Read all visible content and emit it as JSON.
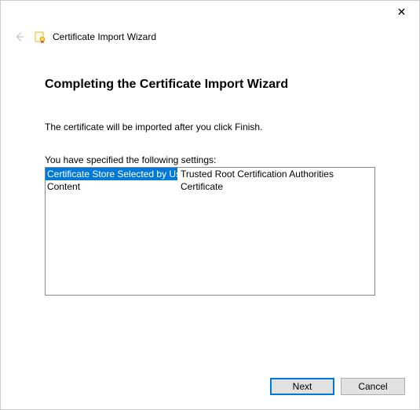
{
  "window": {
    "wizard_name": "Certificate Import Wizard"
  },
  "page": {
    "heading": "Completing the Certificate Import Wizard",
    "info": "The certificate will be imported after you click Finish.",
    "settings_label": "You have specified the following settings:"
  },
  "settings": {
    "rows": [
      {
        "label": "Certificate Store Selected by User",
        "value": "Trusted Root Certification Authorities",
        "selected": true
      },
      {
        "label": "Content",
        "value": "Certificate",
        "selected": false
      }
    ]
  },
  "buttons": {
    "next": "Next",
    "cancel": "Cancel"
  }
}
